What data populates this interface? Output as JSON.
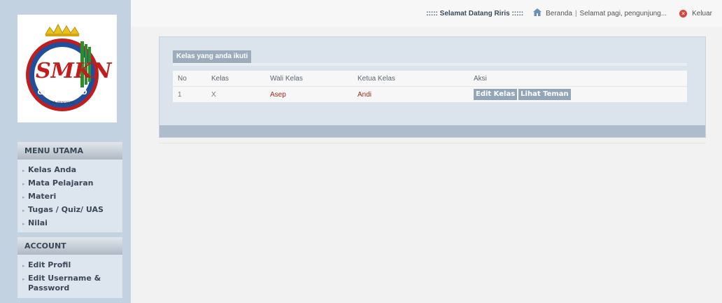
{
  "logo": {
    "name_text": "GADINGREJO",
    "sub_text": "KAB. PRINGSEWU",
    "initials": "SMKN"
  },
  "topbar": {
    "welcome": "::::: Selamat Datang Riris :::::",
    "home": "Beranda",
    "greeting": "Selamat pagi, pengunjung...",
    "logout": "Keluar"
  },
  "menu_utama": {
    "title": "MENU UTAMA",
    "items": [
      "Kelas Anda",
      "Mata Pelajaran",
      "Materi",
      "Tugas / Quiz/ UAS",
      "Nilai"
    ]
  },
  "account": {
    "title": "ACCOUNT",
    "items": [
      "Edit Profil",
      "Edit Username & Password"
    ]
  },
  "panel": {
    "title": "Kelas yang anda ikuti",
    "columns": [
      "No",
      "Kelas",
      "Wali Kelas",
      "Ketua Kelas",
      "Aksi"
    ],
    "rows": [
      {
        "no": "1",
        "kelas": "X",
        "wali": "Asep",
        "ketua": "Andi",
        "btn_edit": "Edit Kelas",
        "btn_lihat": "Lihat Teman"
      }
    ]
  },
  "colors": {
    "sidebar_bg": "#c3d2e1",
    "accent_red": "#a02a1e",
    "button_bg": "#93a5b8"
  }
}
